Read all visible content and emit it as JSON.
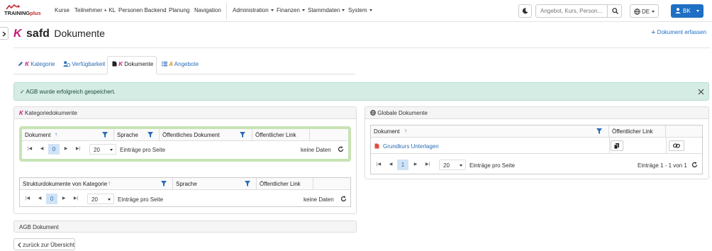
{
  "brand": {
    "name_main": "TRAINING",
    "name_suffix": "plus"
  },
  "nav": {
    "links": [
      "Kurse",
      "Teilnehmer + KL",
      "Personen Backend",
      "Planung",
      "Navigation"
    ],
    "dropdowns": [
      "Administration",
      "Finanzen",
      "Stammdaten",
      "System"
    ]
  },
  "header": {
    "search_placeholder": "Angebot, Kurs, Person...",
    "language": "DE",
    "user_initials": "BK"
  },
  "page": {
    "entity_letter": "K",
    "entity_name": "safd",
    "title": "Dokumente",
    "add_button": "Dokument erfassen"
  },
  "tabs": [
    {
      "letter": "K",
      "label": "Kategorie",
      "icon": "pencil-icon"
    },
    {
      "letter": "",
      "label": "Verfügbarkeit",
      "icon": "user-clock-icon"
    },
    {
      "letter": "K",
      "label": "Dokumente",
      "icon": "file-icon",
      "active": true
    },
    {
      "letter": "A",
      "label": "Angebote",
      "icon": "list-icon"
    }
  ],
  "alert": {
    "message": "AGB wurde erfolgreich gespeichert."
  },
  "kategorie_panel": {
    "letter": "K",
    "title": "Kategoriedokumente",
    "grid1": {
      "columns": [
        "Dokument",
        "Sprache",
        "Öffentliches Dokument",
        "Öffentlicher Link"
      ],
      "page": "0",
      "page_size": "20",
      "per_page_label": "Einträge pro Seite",
      "empty_label": "keine Daten"
    },
    "grid2": {
      "columns": [
        "Strukturdokumente von Kategorie",
        "Sprache",
        "Öffentlicher Link"
      ],
      "page": "0",
      "page_size": "20",
      "per_page_label": "Einträge pro Seite",
      "empty_label": "keine Daten"
    }
  },
  "global_panel": {
    "title": "Globale Dokumente",
    "columns": [
      "Dokument",
      "Öffentlicher Link"
    ],
    "rows": [
      {
        "document": "Grundkurs Unterlagen"
      }
    ],
    "page": "1",
    "page_size": "20",
    "per_page_label": "Einträge pro Seite",
    "summary": "Einträge 1 - 1 von 1"
  },
  "agb_panel": {
    "title": "AGB Dokument"
  },
  "back_button": "zurück zur Übersicht",
  "colors": {
    "primary": "#1f6fc4",
    "category": "#c4187a",
    "offer": "#e28f12",
    "success_bg": "#d4ece3",
    "highlight_border": "#c7e3b5"
  }
}
